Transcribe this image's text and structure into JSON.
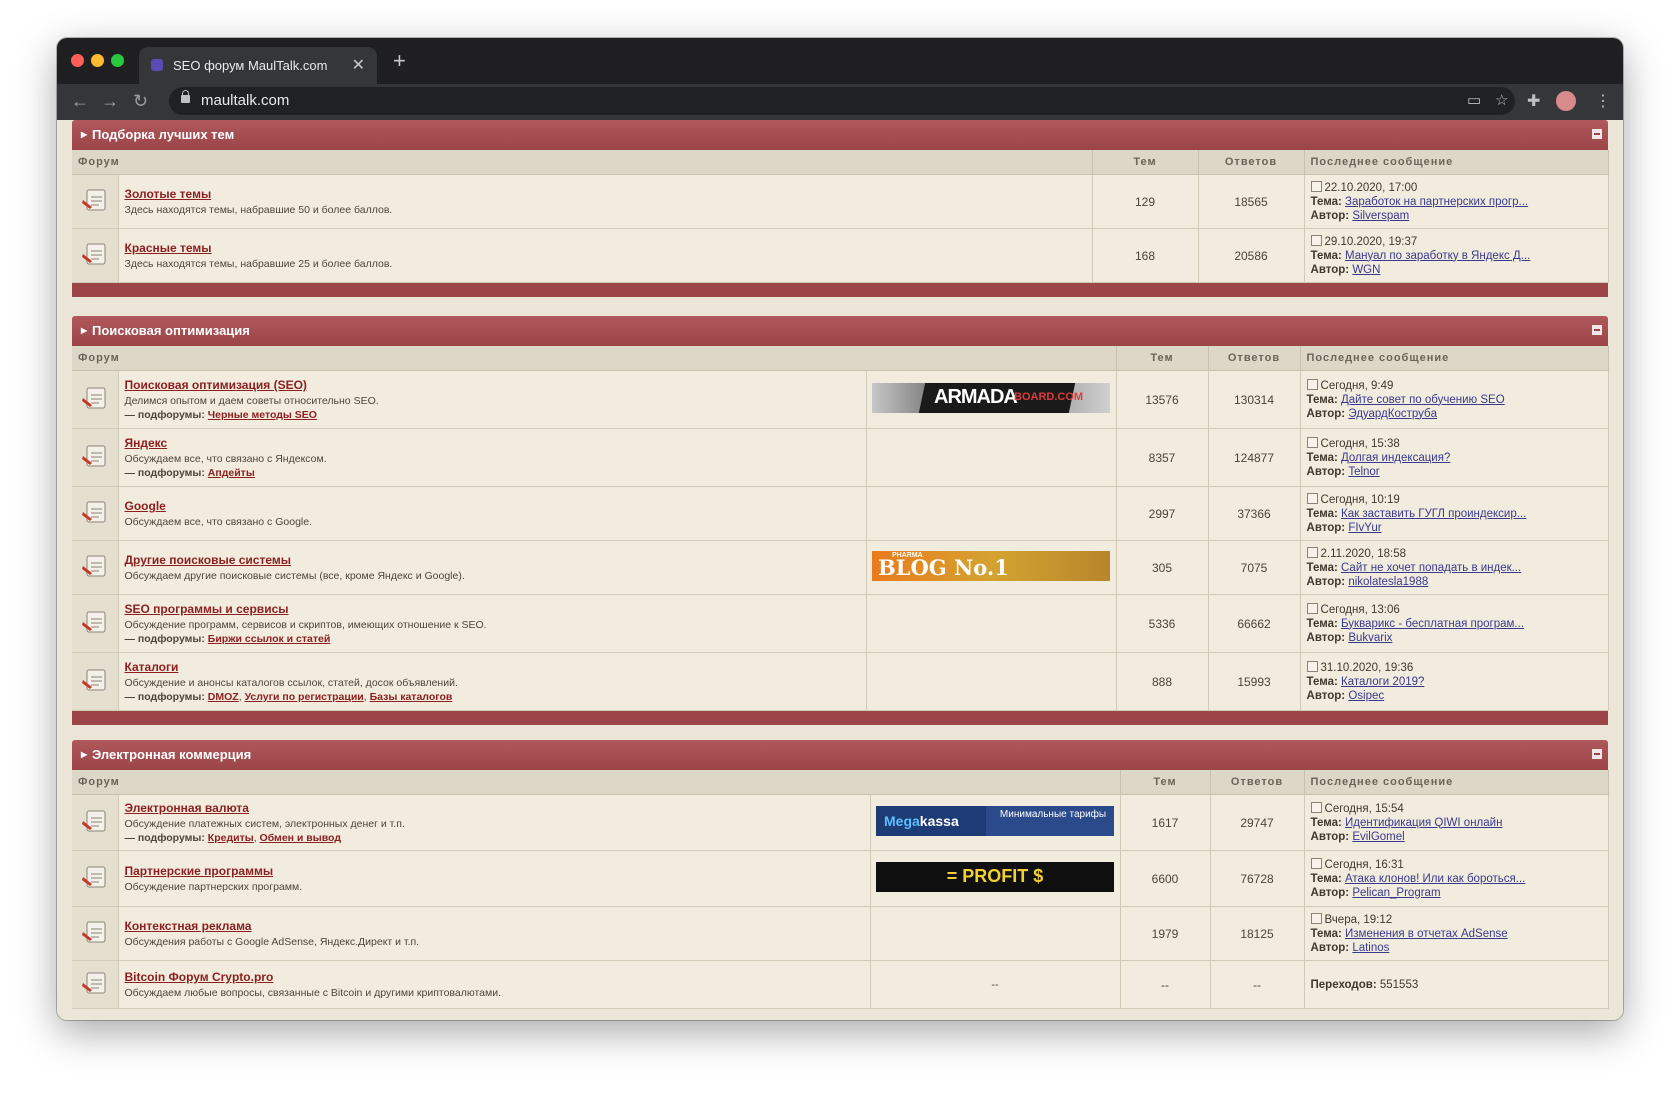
{
  "browser": {
    "tab_title": "SEO форум MaulTalk.com",
    "tab_close": "✕",
    "new_tab": "+",
    "url": "maultalk.com"
  },
  "columns": {
    "forum": "Форум",
    "topics": "Тем",
    "replies": "Ответов",
    "last": "Последнее сообщение",
    "topic_prefix": "Тема:",
    "author_prefix": "Автор:",
    "subforums_prefix": "— подфорумы:"
  },
  "sections": [
    {
      "title": "Подборка лучших тем",
      "forums": [
        {
          "title": "Золотые темы",
          "desc": "Здесь находятся темы, набравшие 50 и более баллов.",
          "topics": "129",
          "replies": "18565",
          "last": {
            "date": "22.10.2020, 17:00",
            "topic": "Заработок на партнерских прогр...",
            "author": "Silverspam"
          }
        },
        {
          "title": "Красные темы",
          "desc": "Здесь находятся темы, набравшие 25 и более баллов.",
          "topics": "168",
          "replies": "20586",
          "last": {
            "date": "29.10.2020, 19:37",
            "topic": "Мануал по заработку в Яндекс Д...",
            "author": "WGN"
          }
        }
      ]
    },
    {
      "title": "Поисковая оптимизация",
      "forums": [
        {
          "title": "Поисковая оптимизация (SEO)",
          "desc": "Делимся опытом и даем советы относительно SEO.",
          "subforums": [
            "Черные методы SEO"
          ],
          "banner": "armada",
          "topics": "13576",
          "replies": "130314",
          "last": {
            "date": "Сегодня, 9:49",
            "topic": "Дайте совет по обучению SEO",
            "author": "ЭдуардКострубa"
          }
        },
        {
          "title": "Яндекс",
          "desc": "Обсуждаем все, что связано с Яндексом.",
          "subforums": [
            "Апдейты"
          ],
          "topics": "8357",
          "replies": "124877",
          "last": {
            "date": "Сегодня, 15:38",
            "topic": "Долгая индексация?",
            "author": "Telnor"
          }
        },
        {
          "title": "Google",
          "desc": "Обсуждаем все, что связано с Google.",
          "topics": "2997",
          "replies": "37366",
          "last": {
            "date": "Сегодня, 10:19",
            "topic": "Как заставить ГУГЛ проиндексир...",
            "author": "FIvYur"
          }
        },
        {
          "title": "Другие поисковые системы",
          "desc": "Обсуждаем другие поисковые системы (все, кроме Яндекс и Google).",
          "banner": "blog",
          "topics": "305",
          "replies": "7075",
          "last": {
            "date": "2.11.2020, 18:58",
            "topic": "Сайт не хочет попадать в индек...",
            "author": "nikolatesla1988"
          }
        },
        {
          "title": "SEO программы и сервисы",
          "desc": "Обсуждение программ, сервисов и скриптов, имеющих отношение к SEO.",
          "subforums": [
            "Биржи ссылок и статей"
          ],
          "topics": "5336",
          "replies": "66662",
          "last": {
            "date": "Сегодня, 13:06",
            "topic": "Букварикс - бесплатная програм...",
            "author": "Bukvarix"
          }
        },
        {
          "title": "Каталоги",
          "desc": "Обсуждение и анонсы каталогов ссылок, статей, досок объявлений.",
          "subforums": [
            "DMOZ",
            "Услуги по регистрации",
            "Базы каталогов"
          ],
          "topics": "888",
          "replies": "15993",
          "last": {
            "date": "31.10.2020, 19:36",
            "topic": "Каталоги 2019?",
            "author": "Osipec"
          }
        }
      ]
    },
    {
      "title": "Электронная коммерция",
      "forums": [
        {
          "title": "Электронная валюта",
          "desc": "Обсуждение платежных систем, электронных денег и т.п.",
          "subforums": [
            "Кредиты",
            "Обмен и вывод"
          ],
          "banner": "mega",
          "topics": "1617",
          "replies": "29747",
          "last": {
            "date": "Сегодня, 15:54",
            "topic": "Идентификация QIWI онлайн",
            "author": "EvilGomel"
          }
        },
        {
          "title": "Партнерские программы",
          "desc": "Обсуждение партнерских программ.",
          "banner": "profit",
          "topics": "6600",
          "replies": "76728",
          "last": {
            "date": "Сегодня, 16:31",
            "topic": "Атака клонов! Или как бороться...",
            "author": "Pelican_Program"
          }
        },
        {
          "title": "Контекстная реклама",
          "desc": "Обсуждения работы с Google AdSense, Яндекс.Директ и т.п.",
          "topics": "1979",
          "replies": "18125",
          "last": {
            "date": "Вчера, 19:12",
            "topic": "Изменения в отчетах AdSense",
            "author": "Latinos"
          }
        },
        {
          "title": "Bitcoin Форум Crypto.pro",
          "desc": "Обсуждаем любые вопросы, связанные с Bitcoin и другими криптовалютами.",
          "redirect": true,
          "banner_text": "--",
          "topics": "--",
          "replies": "--",
          "redirects_label": "Переходов:",
          "redirects": "551553"
        }
      ]
    }
  ],
  "banners": {
    "armada": {
      "main": "ARMADA",
      "sub": "BOARD.COM"
    },
    "blog": {
      "top": "PHARMA",
      "main": "BLOG No.1"
    },
    "mega": {
      "a": "Mega",
      "b": "kassa",
      "right": "Минимальные тарифы"
    },
    "profit": {
      "main": "= PROFIT $"
    }
  },
  "colors": {
    "category_header": "#9b4549",
    "link": "#8c1f1f",
    "page_bg": "#ebe6d8"
  }
}
